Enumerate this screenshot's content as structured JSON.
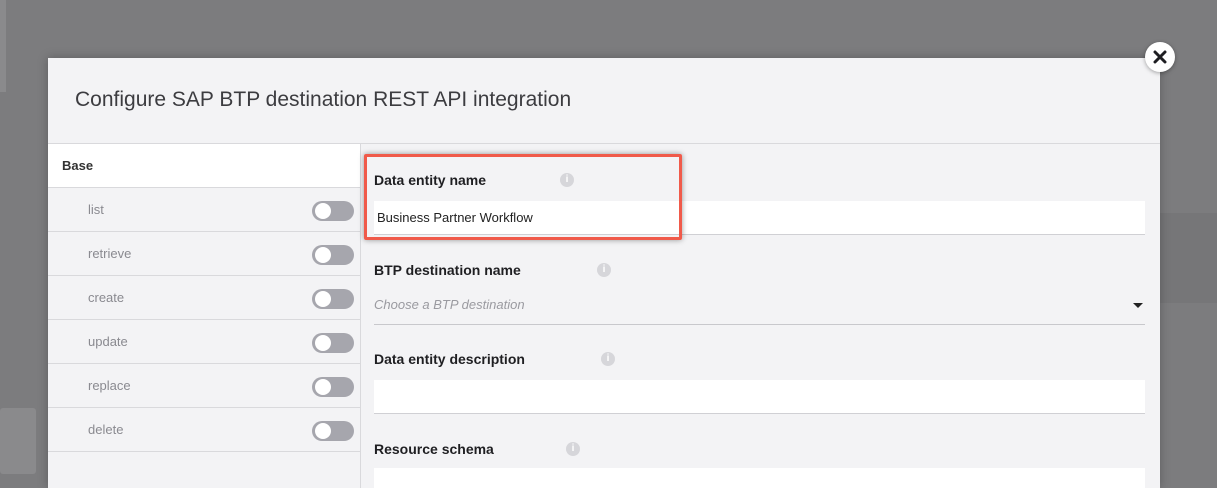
{
  "modal": {
    "title": "Configure SAP BTP destination REST API integration"
  },
  "sidebar": {
    "header": "Base",
    "operations": [
      {
        "label": "list",
        "enabled": false
      },
      {
        "label": "retrieve",
        "enabled": false
      },
      {
        "label": "create",
        "enabled": false
      },
      {
        "label": "update",
        "enabled": false
      },
      {
        "label": "replace",
        "enabled": false
      },
      {
        "label": "delete",
        "enabled": false
      }
    ]
  },
  "form": {
    "data_entity_name": {
      "label": "Data entity name",
      "value": "Business Partner Workflow"
    },
    "btp_destination": {
      "label": "BTP destination name",
      "placeholder": "Choose a BTP destination"
    },
    "data_entity_description": {
      "label": "Data entity description",
      "value": ""
    },
    "resource_schema": {
      "label": "Resource schema"
    }
  },
  "icons": {
    "close": "close-icon",
    "info": "info-icon",
    "dropdown": "chevron-down-icon"
  },
  "colors": {
    "highlight": "#f05a4a",
    "toggle_off": "#a6a6ad",
    "backdrop": "#7c7c7e"
  }
}
